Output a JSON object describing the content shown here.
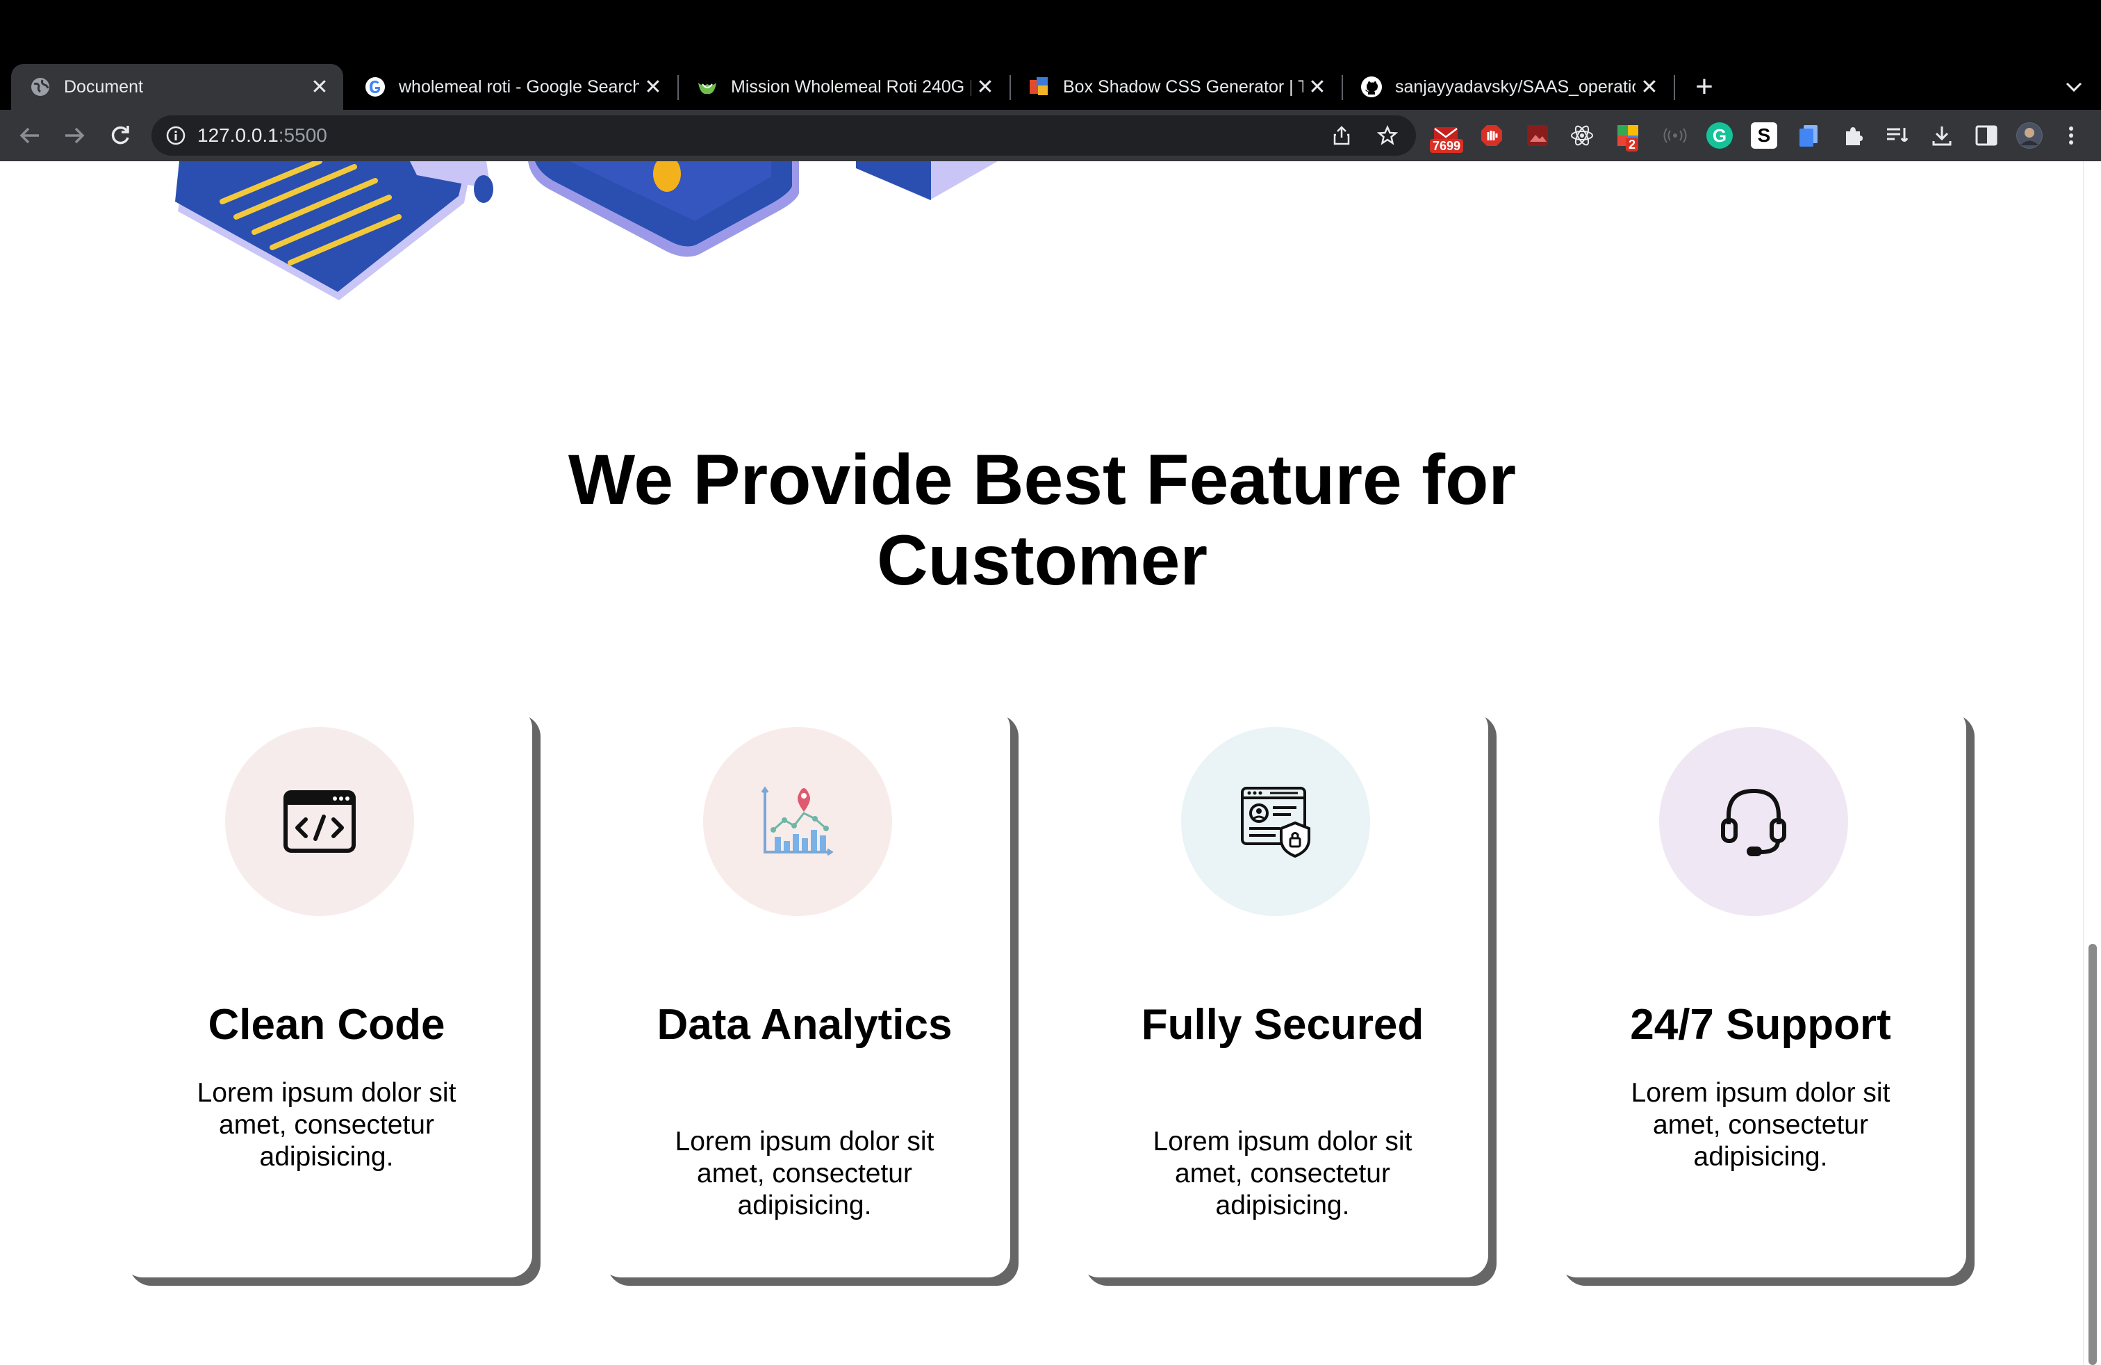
{
  "browser": {
    "tabs": [
      {
        "title": "Document",
        "icon": "globe-icon",
        "active": true
      },
      {
        "title": "wholemeal roti - Google Search",
        "icon": "google-icon"
      },
      {
        "title": "Mission Wholemeal Roti 240G | W",
        "icon": "woolworths-icon"
      },
      {
        "title": "Box Shadow CSS Generator | Th",
        "icon": "cssmatic-icon"
      },
      {
        "title": "sanjayyadavsky/SAAS_operatio",
        "icon": "github-icon"
      }
    ],
    "url_host": "127.0.0.1",
    "url_port": ":5500",
    "extensions": {
      "mail_badge": "7699",
      "grid_badge": "2"
    }
  },
  "features": {
    "title": "We Provide Best Feature for Customer",
    "cards": [
      {
        "title": "Clean Code",
        "description": "Lorem ipsum dolor sit amet, consectetur adipisicing.",
        "icon": "code-window-icon",
        "bg": "#f7ecec"
      },
      {
        "title": "Data Analytics",
        "description": "Lorem ipsum dolor sit amet, consectetur adipisicing.",
        "icon": "analytics-chart-icon",
        "bg": "#f8ecea"
      },
      {
        "title": "Fully Secured",
        "description": "Lorem ipsum dolor sit amet, consectetur adipisicing.",
        "icon": "secure-profile-icon",
        "bg": "#eaf3f6"
      },
      {
        "title": "24/7 Support",
        "description": "Lorem ipsum dolor sit amet, consectetur adipisicing.",
        "icon": "headset-icon",
        "bg": "#efe8f4"
      }
    ]
  },
  "colors": {
    "illustration_blue": "#2a4fb0",
    "illustration_lavender": "#b9b8f2",
    "illustration_yellow": "#f3c93c",
    "card_shadow": "#666666"
  }
}
